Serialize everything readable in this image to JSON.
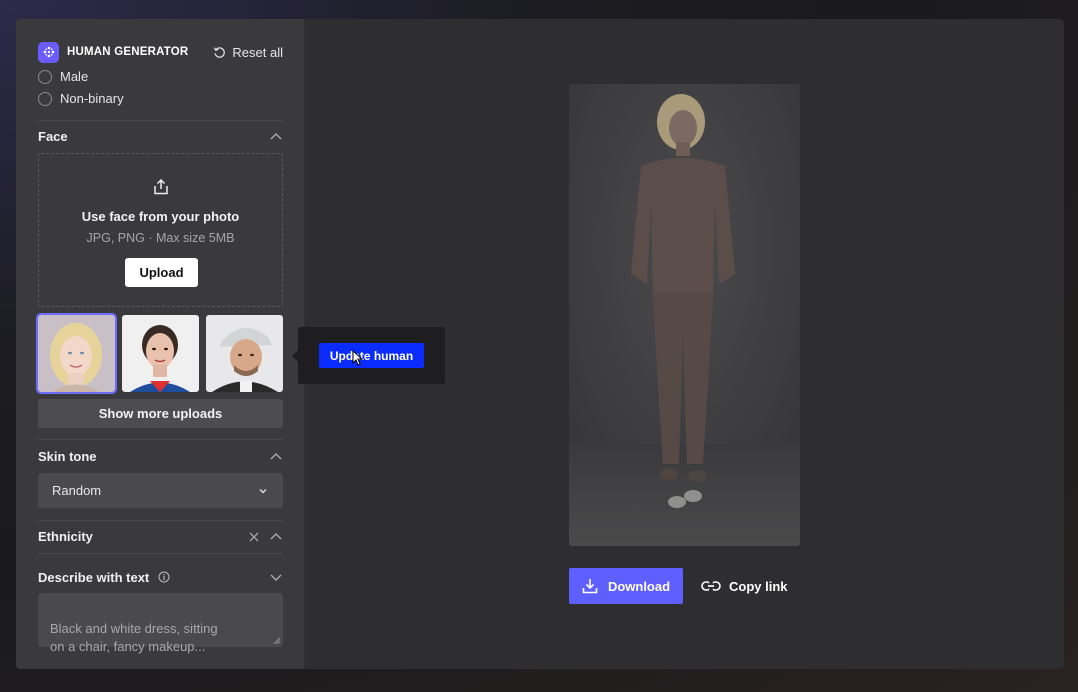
{
  "header": {
    "brand": "HUMAN GENERATOR",
    "reset_label": "Reset all",
    "logo_color": "#6a5cff"
  },
  "gender": {
    "options": [
      {
        "label": "Male",
        "selected": false
      },
      {
        "label": "Non-binary",
        "selected": false
      }
    ]
  },
  "face": {
    "title": "Face",
    "upload_title": "Use face from your photo",
    "upload_hint": "JPG, PNG · Max size 5MB",
    "upload_button": "Upload",
    "thumbnails": [
      {
        "name": "blonde-woman",
        "selected": true
      },
      {
        "name": "dark-haired-woman",
        "selected": false
      },
      {
        "name": "man-with-cap",
        "selected": false
      }
    ],
    "show_more": "Show more uploads"
  },
  "tooltip": {
    "button": "Update human",
    "button_color": "#0a2cff"
  },
  "skin_tone": {
    "title": "Skin tone",
    "value": "Random"
  },
  "ethnicity": {
    "title": "Ethnicity"
  },
  "describe": {
    "title": "Describe with text",
    "placeholder": "Black and white dress, sitting\non a chair, fancy makeup..."
  },
  "preview": {
    "download_label": "Download",
    "copy_label": "Copy link",
    "accent": "#5f5fff"
  }
}
